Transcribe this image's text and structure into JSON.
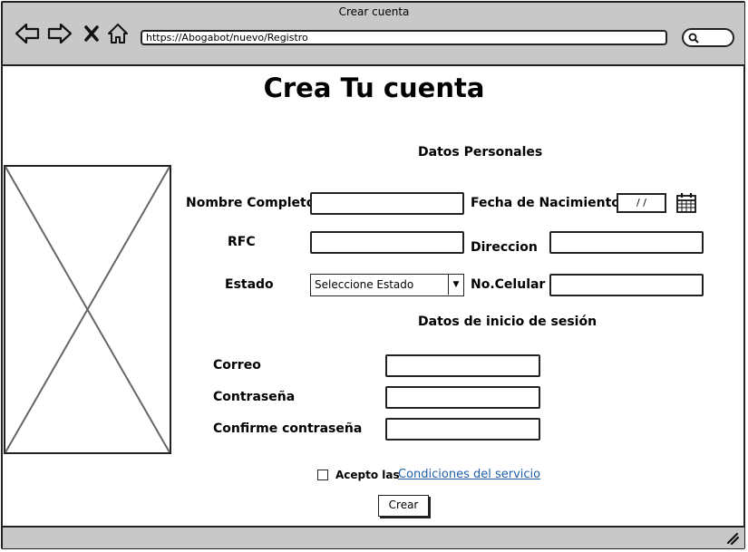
{
  "window": {
    "title": "Crear cuenta"
  },
  "browser": {
    "url": "https://Abogabot/nuevo/Registro",
    "icons": [
      "back-arrow-icon",
      "forward-arrow-icon",
      "close-x-icon",
      "home-icon",
      "search-icon",
      "calendar-icon",
      "resize-grip-icon"
    ]
  },
  "page": {
    "title": "Crea Tu cuenta"
  },
  "personal": {
    "heading": "Datos Personales",
    "nombre_label": "Nombre Completo",
    "fecha_label": "Fecha de Nacimiento",
    "fecha_value": "/ /",
    "rfc_label": "RFC",
    "direccion_label": "Direccion",
    "estado_label": "Estado",
    "estado_selected": "Seleccione Estado",
    "celular_label": "No.Celular"
  },
  "login": {
    "heading": "Datos de inicio de sesión",
    "correo_label": "Correo",
    "password_label": "Contraseña",
    "confirm_label": "Confirme contraseña"
  },
  "terms": {
    "accept_label": "Acepto las",
    "link_text": "Condiciones del servicio"
  },
  "actions": {
    "submit_label": "Crear"
  }
}
